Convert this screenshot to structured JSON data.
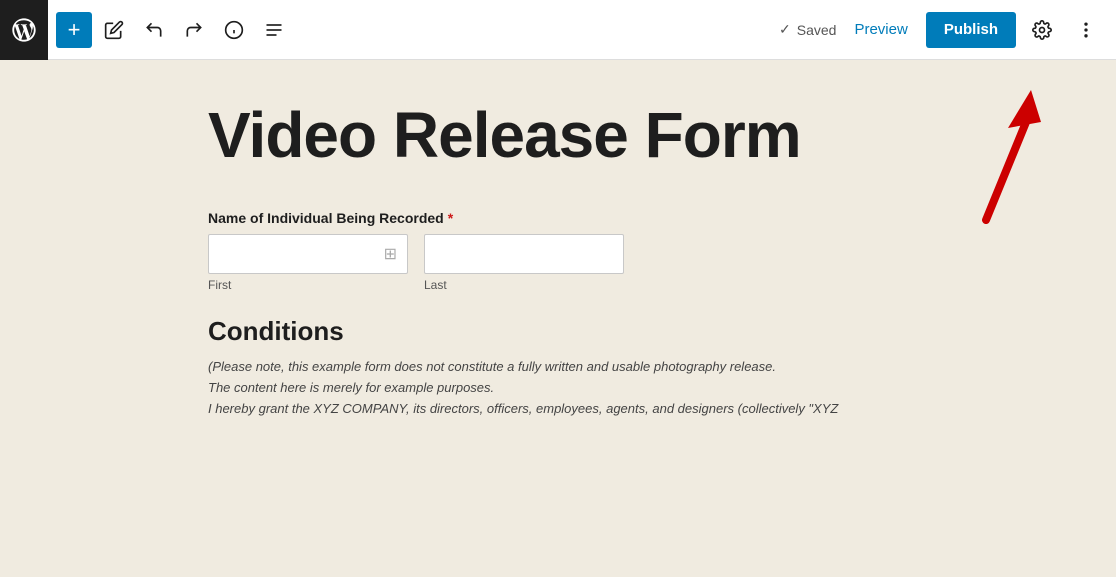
{
  "toolbar": {
    "add_label": "+",
    "saved_text": "Saved",
    "preview_label": "Preview",
    "publish_label": "Publish"
  },
  "page": {
    "title": "Video Release Form",
    "form": {
      "name_label": "Name of Individual Being Recorded",
      "required_star": "*",
      "first_sub": "First",
      "last_sub": "Last"
    },
    "conditions": {
      "heading": "Conditions",
      "text_line1": "(Please note, this example form does not constitute a fully written and usable photography release.",
      "text_line2": "The content here is merely for example purposes.",
      "text_line3": "I hereby grant the XYZ COMPANY, its directors, officers, employees, agents, and designers (collectively \"XYZ"
    }
  }
}
